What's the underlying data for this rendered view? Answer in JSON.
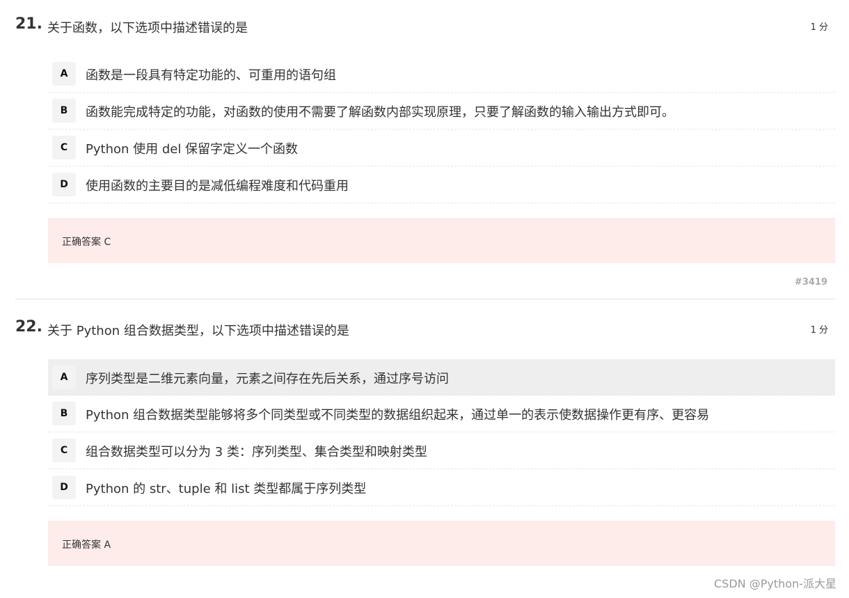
{
  "questions": [
    {
      "number": "21.",
      "title": "关于函数，以下选项中描述错误的是",
      "score": "1 分",
      "options": [
        {
          "letter": "A",
          "text": "函数是一段具有特定功能的、可重用的语句组"
        },
        {
          "letter": "B",
          "text": "函数能完成特定的功能，对函数的使用不需要了解函数内部实现原理，只要了解函数的输入输出方式即可。"
        },
        {
          "letter": "C",
          "text": "Python 使用 del 保留字定义一个函数"
        },
        {
          "letter": "D",
          "text": "使用函数的主要目的是减低编程难度和代码重用"
        }
      ],
      "answer": "正确答案 C",
      "id": "#3419"
    },
    {
      "number": "22.",
      "title": "关于 Python 组合数据类型，以下选项中描述错误的是",
      "score": "1 分",
      "options": [
        {
          "letter": "A",
          "text": "序列类型是二维元素向量，元素之间存在先后关系，通过序号访问"
        },
        {
          "letter": "B",
          "text": "Python 组合数据类型能够将多个同类型或不同类型的数据组织起来，通过单一的表示使数据操作更有序、更容易"
        },
        {
          "letter": "C",
          "text": "组合数据类型可以分为 3 类：序列类型、集合类型和映射类型"
        },
        {
          "letter": "D",
          "text": "Python 的 str、tuple 和 list 类型都属于序列类型"
        }
      ],
      "answer": "正确答案 A"
    }
  ],
  "watermark": "CSDN @Python-派大星",
  "colors": {
    "answer_bg": "#fdecea",
    "highlight_bg": "#eeeeee",
    "letter_bg": "#f3f3f3"
  }
}
